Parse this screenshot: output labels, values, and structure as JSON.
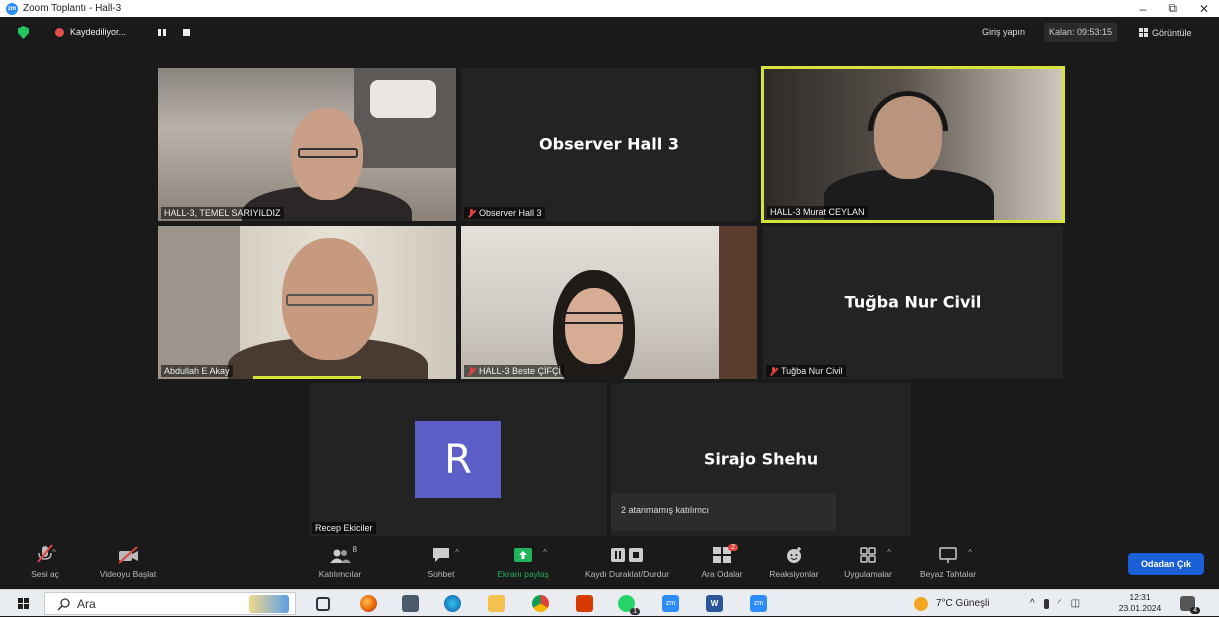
{
  "window": {
    "title": "Zoom Toplantı - Hall-3",
    "controls": {
      "minimize": "–",
      "restore": "⧉",
      "close": "✕"
    }
  },
  "topbar": {
    "recording_status": "Kaydediliyor...",
    "sign_in": "Giriş yapın",
    "remaining": "Kalan: 09:53:15",
    "view": "Görüntüle"
  },
  "participants": [
    {
      "name": "HALL-3, TEMEL SARIYILDIZ",
      "video": true,
      "muted": false
    },
    {
      "name": "Observer Hall 3",
      "display_name": "Observer Hall 3",
      "video": false,
      "muted": true
    },
    {
      "name": "HALL-3 Murat CEYLAN",
      "video": true,
      "muted": false,
      "active_speaker": true
    },
    {
      "name": "Abdullah E Akay",
      "video": true,
      "muted": false
    },
    {
      "name": "HALL-3 Beste ÇİFÇİ",
      "video": true,
      "muted": true
    },
    {
      "name": "Tuğba Nur Civil",
      "display_name": "Tuğba Nur Civil",
      "video": false,
      "muted": true
    },
    {
      "name": "Recep Ekiciler",
      "avatar_letter": "R",
      "video": false,
      "muted": false
    },
    {
      "name": "Sirajo Shehu",
      "display_name": "Sirajo Shehu",
      "video": false,
      "muted": false
    }
  ],
  "tooltip": "2 atanmamış katılımcı",
  "toolbar": {
    "unmute": "Sesi aç",
    "start_video": "Videoyu Başlat",
    "participants": "Katılımcılar",
    "participants_count": "8",
    "chat": "Sohbet",
    "share_screen": "Ekranı paylaş",
    "record": "Kaydı Duraklat/Durdur",
    "breakout_rooms": "Ara Odalar",
    "breakout_badge": "2",
    "reactions": "Reaksiyonlar",
    "apps": "Uygulamalar",
    "whiteboard": "Beyaz Tahtalar",
    "leave": "Odadan Çık"
  },
  "taskbar": {
    "search_placeholder": "Ara",
    "weather": "7°C Güneşli",
    "time": "12:31",
    "date": "23.01.2024",
    "notification_count": "4",
    "whatsapp_badge": "1"
  },
  "colors": {
    "active_speaker_border": "#d6e33a",
    "accent_blue": "#1b5fd6",
    "muted_red": "#e0443e",
    "avatar_purple": "#5b5fc7",
    "share_green": "#1fb35a"
  }
}
